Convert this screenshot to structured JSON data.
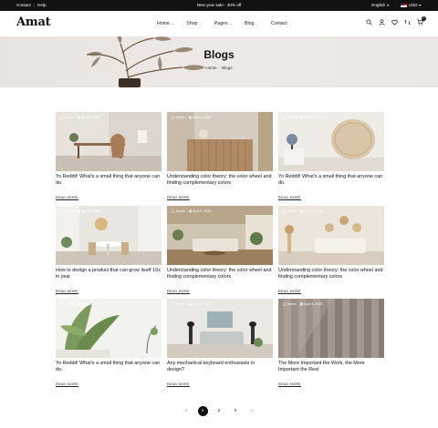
{
  "topbar": {
    "links": [
      "Contact",
      "Help"
    ],
    "promo": "New year sale - 20% off",
    "language": "English",
    "currency": "USD"
  },
  "header": {
    "logo": "Amat",
    "nav": [
      {
        "label": "Home",
        "dropdown": true
      },
      {
        "label": "Shop",
        "dropdown": true
      },
      {
        "label": "Pages",
        "dropdown": true
      },
      {
        "label": "Blog",
        "dropdown": true
      },
      {
        "label": "Contact",
        "dropdown": false
      }
    ],
    "cart_count": "0"
  },
  "hero": {
    "title": "Blogs",
    "breadcrumb": [
      "Home",
      "Blogs"
    ]
  },
  "posts": [
    {
      "author": "Admin",
      "date": "April 6, 2025",
      "title": "Yo Reddit! What's a small thing that anyone can do.",
      "more": "READ MORE"
    },
    {
      "author": "Admin",
      "date": "April 6, 2025",
      "title": "Understanding color theory: the color wheel and finding complementary colors",
      "more": "READ MORE"
    },
    {
      "author": "Admin",
      "date": "April 6, 2025",
      "title": "Yo Reddit! What's a small thing that anyone can do.",
      "more": "READ MORE"
    },
    {
      "author": "Admin",
      "date": "April 6, 2025",
      "title": "How to design a product that can grow itself 10x in year",
      "more": "READ MORE"
    },
    {
      "author": "Admin",
      "date": "April 6, 2025",
      "title": "Understanding color theory: the color wheel and finding complementary colors",
      "more": "READ MORE"
    },
    {
      "author": "Admin",
      "date": "April 6, 2025",
      "title": "Understanding color theory: the color wheel and finding complementary colors",
      "more": "READ MORE"
    },
    {
      "author": "Admin",
      "date": "April 6, 2025",
      "title": "Yo Reddit! What's a small thing that anyone can do.",
      "more": "READ MORE"
    },
    {
      "author": "Admin",
      "date": "April 6, 2025",
      "title": "Any mechanical keyboard enthusiasts in design?",
      "more": "READ MORE"
    },
    {
      "author": "Admin",
      "date": "April 6, 2025",
      "title": "The More Important the Work, the More Important the Rest",
      "more": "READ MORE"
    }
  ],
  "pagination": {
    "pages": [
      "1",
      "2",
      "3"
    ],
    "current": "1"
  },
  "colors": {
    "topbar": "#111111",
    "hero_bg": "#ebe6e3",
    "accent": "#111111"
  }
}
